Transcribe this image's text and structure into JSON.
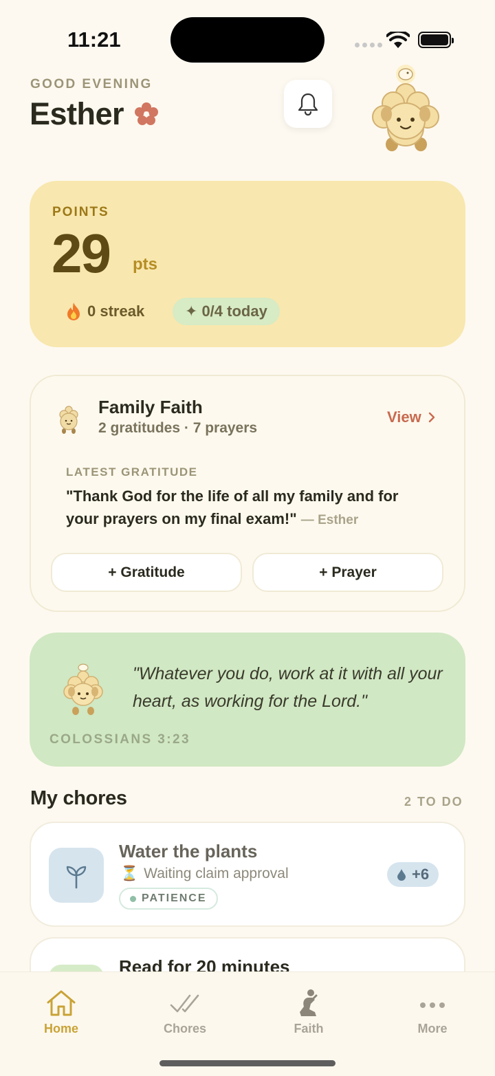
{
  "status": {
    "time": "11:21"
  },
  "header": {
    "greeting": "GOOD EVENING",
    "name": "Esther"
  },
  "points": {
    "label": "POINTS",
    "value": "29",
    "unit": "pts",
    "streak": "0 streak",
    "today": "0/4 today"
  },
  "family_faith": {
    "title": "Family Faith",
    "subtitle": "2 gratitudes · 7 prayers",
    "view_label": "View",
    "latest_label": "LATEST GRATITUDE",
    "latest_quote": "\"Thank God for the life of all my family and for your prayers on my final exam!\"",
    "latest_author": "— Esther",
    "gratitude_button": "+ Gratitude",
    "prayer_button": "+ Prayer"
  },
  "verse": {
    "text": "\"Whatever you do, work at it with all your heart, as working for the Lord.\"",
    "reference": "COLOSSIANS 3:23"
  },
  "chores": {
    "title": "My chores",
    "count": "2 TO DO",
    "items": [
      {
        "name": "Water the plants",
        "status": "Waiting claim approval",
        "tag": "PATIENCE",
        "points": "+6"
      },
      {
        "name": "Read for 20 minutes"
      }
    ]
  },
  "tabs": [
    {
      "label": "Home",
      "icon": "home-icon"
    },
    {
      "label": "Chores",
      "icon": "checks-icon"
    },
    {
      "label": "Faith",
      "icon": "praying-icon"
    },
    {
      "label": "More",
      "icon": "more-icon"
    }
  ],
  "colors": {
    "accent": "#c9a336",
    "points_card": "#f8e7ae",
    "verse_card": "#d0e8c3",
    "link": "#c86a4f"
  }
}
